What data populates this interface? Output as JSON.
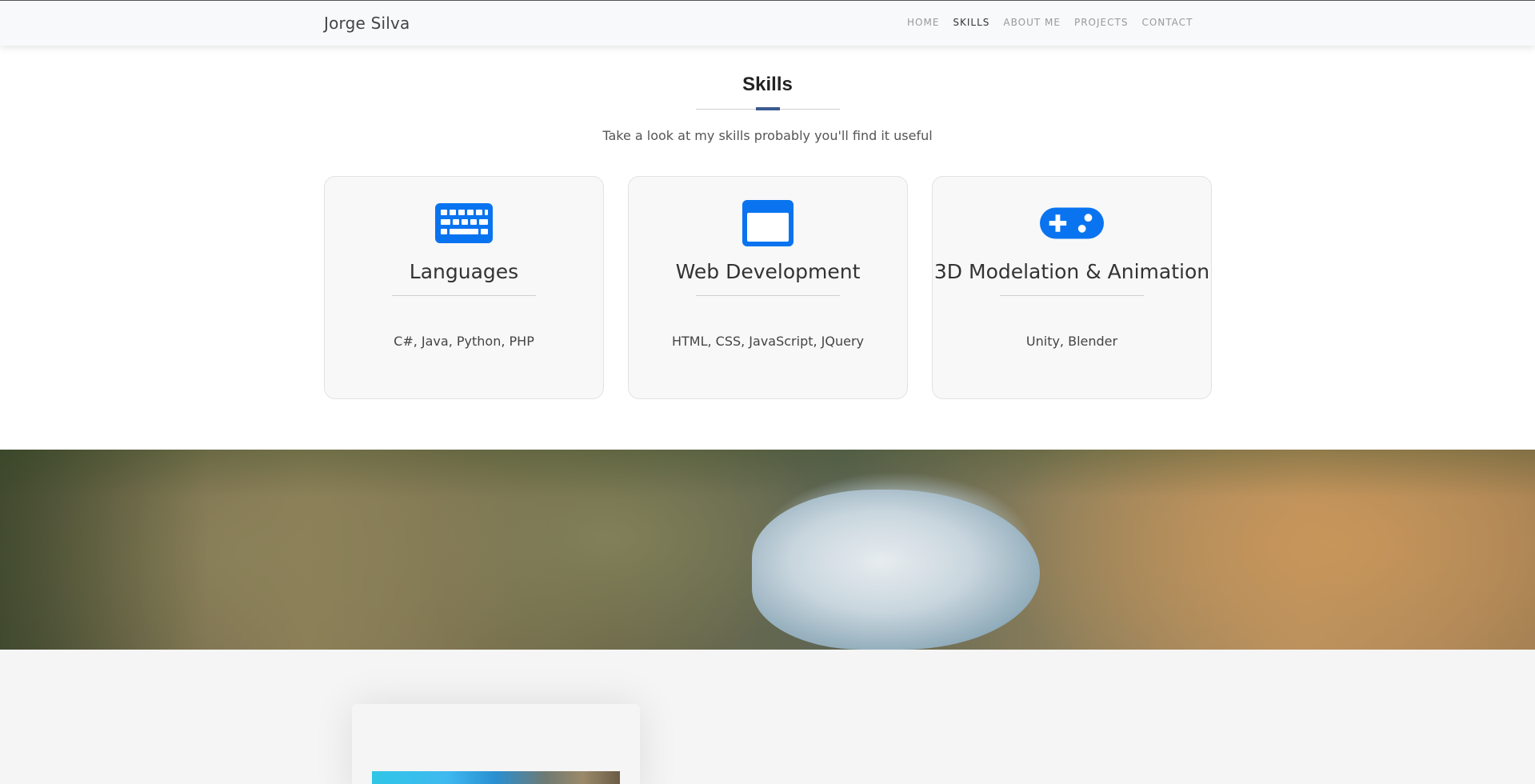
{
  "navbar": {
    "brand": "Jorge Silva",
    "items": [
      {
        "label": "HOME",
        "active": false
      },
      {
        "label": "SKILLS",
        "active": true
      },
      {
        "label": "ABOUT ME",
        "active": false
      },
      {
        "label": "PROJECTS",
        "active": false
      },
      {
        "label": "CONTACT",
        "active": false
      }
    ]
  },
  "skills": {
    "title": "Skills",
    "subtitle": "Take a look at my skills probably you'll find it useful",
    "cards": [
      {
        "icon": "keyboard-icon",
        "title": "Languages",
        "text": "C#, Java, Python, PHP"
      },
      {
        "icon": "browser-window-icon",
        "title": "Web Development",
        "text": "HTML, CSS, JavaScript, JQuery"
      },
      {
        "icon": "gamepad-icon",
        "title": "3D Modelation & Animation",
        "text": "Unity, Blender"
      }
    ]
  },
  "colors": {
    "accent": "#3b5a8f",
    "icon": "#0a74f0",
    "navbar_bg": "#f8f9fa"
  }
}
